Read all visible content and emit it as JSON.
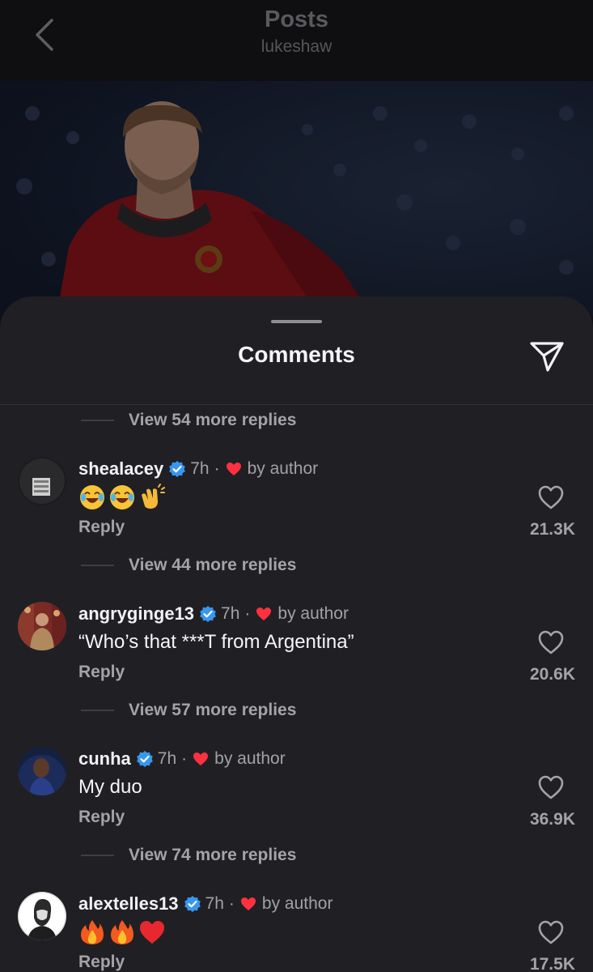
{
  "header": {
    "title": "Posts",
    "subtitle": "lukeshaw"
  },
  "sheet": {
    "title": "Comments"
  },
  "replies_labels": [
    "View 54 more replies",
    "View 44 more replies",
    "View 57 more replies",
    "View 74 more replies"
  ],
  "comments": [
    {
      "username": "shealacey",
      "verified": true,
      "time": "7h",
      "separator": "·",
      "author_like_label": "by author",
      "text": "",
      "emojis": [
        "joy-emoji",
        "joy-emoji",
        "clapping-emoji"
      ],
      "reply_label": "Reply",
      "like_count": "21.3K"
    },
    {
      "username": "angryginge13",
      "verified": true,
      "time": "7h",
      "separator": "·",
      "author_like_label": "by author",
      "text": "“Who’s that ***T from Argentina”",
      "reply_label": "Reply",
      "like_count": "20.6K"
    },
    {
      "username": "cunha",
      "verified": true,
      "time": "7h",
      "separator": "·",
      "author_like_label": "by author",
      "text": "My duo",
      "reply_label": "Reply",
      "like_count": "36.9K"
    },
    {
      "username": "alextelles13",
      "verified": true,
      "time": "7h",
      "separator": "·",
      "author_like_label": "by author",
      "text": "",
      "emojis": [
        "fire-emoji",
        "fire-emoji",
        "red-heart-emoji"
      ],
      "reply_label": "Reply",
      "like_count": "17.5K"
    }
  ],
  "colors": {
    "verified_blue": "#3897f0",
    "author_heart_red": "#ff3040",
    "sheet_background": "#202024"
  }
}
